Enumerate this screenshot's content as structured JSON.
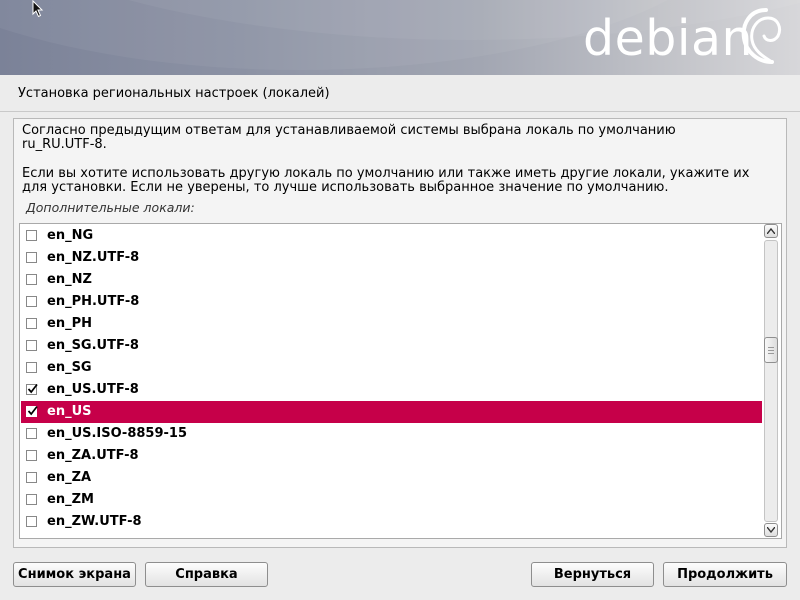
{
  "banner": {
    "logo_text": "debian"
  },
  "title": "Установка региональных настроек (локалей)",
  "description": {
    "paragraph1_line1": "Согласно предыдущим ответам для устанавливаемой системы выбрана локаль по умолчанию",
    "paragraph1_line2": "ru_RU.UTF-8.",
    "paragraph2_line1": "Если вы хотите использовать другую локаль по умолчанию или также иметь другие локали, укажите их",
    "paragraph2_line2": "для установки. Если не уверены, то лучше использовать выбранное значение по умолчанию."
  },
  "list_label": "Дополнительные локали:",
  "locales": [
    {
      "label": "en_NG",
      "checked": false,
      "selected": false
    },
    {
      "label": "en_NZ.UTF-8",
      "checked": false,
      "selected": false
    },
    {
      "label": "en_NZ",
      "checked": false,
      "selected": false
    },
    {
      "label": "en_PH.UTF-8",
      "checked": false,
      "selected": false
    },
    {
      "label": "en_PH",
      "checked": false,
      "selected": false
    },
    {
      "label": "en_SG.UTF-8",
      "checked": false,
      "selected": false
    },
    {
      "label": "en_SG",
      "checked": false,
      "selected": false
    },
    {
      "label": "en_US.UTF-8",
      "checked": true,
      "selected": false
    },
    {
      "label": "en_US",
      "checked": true,
      "selected": true
    },
    {
      "label": "en_US.ISO-8859-15",
      "checked": false,
      "selected": false
    },
    {
      "label": "en_ZA.UTF-8",
      "checked": false,
      "selected": false
    },
    {
      "label": "en_ZA",
      "checked": false,
      "selected": false
    },
    {
      "label": "en_ZM",
      "checked": false,
      "selected": false
    },
    {
      "label": "en_ZW.UTF-8",
      "checked": false,
      "selected": false
    }
  ],
  "scrollbar": {
    "position_fraction": 0.38
  },
  "buttons": {
    "screenshot": "Снимок экрана",
    "help": "Справка",
    "back": "Вернуться",
    "continue": "Продолжить"
  },
  "colors": {
    "selection": "#c60049",
    "background": "#ececec"
  },
  "icons": [
    "mouse-cursor-icon",
    "debian-swirl-icon",
    "checkmark-icon",
    "scroll-up-arrow-icon",
    "scroll-down-arrow-icon"
  ]
}
